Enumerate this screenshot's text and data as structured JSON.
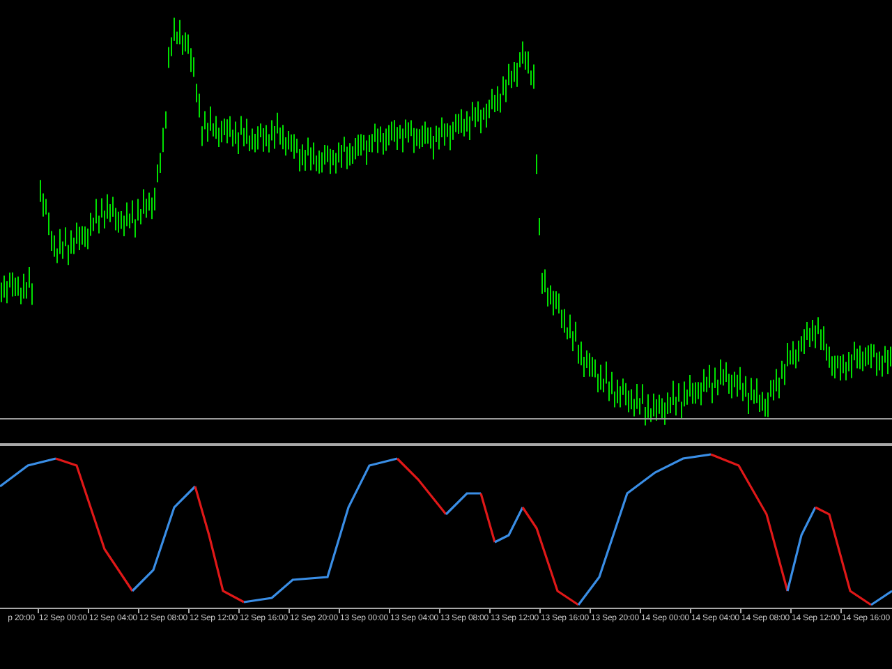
{
  "time_axis": {
    "labels": [
      "p 20:00",
      "12 Sep 00:00",
      "12 Sep 04:00",
      "12 Sep 08:00",
      "12 Sep 12:00",
      "12 Sep 16:00",
      "12 Sep 20:00",
      "13 Sep 00:00",
      "13 Sep 04:00",
      "13 Sep 08:00",
      "13 Sep 12:00",
      "13 Sep 16:00",
      "13 Sep 20:00",
      "14 Sep 00:00",
      "14 Sep 04:00",
      "14 Sep 08:00",
      "14 Sep 12:00",
      "14 Sep 16:00"
    ]
  }
}
